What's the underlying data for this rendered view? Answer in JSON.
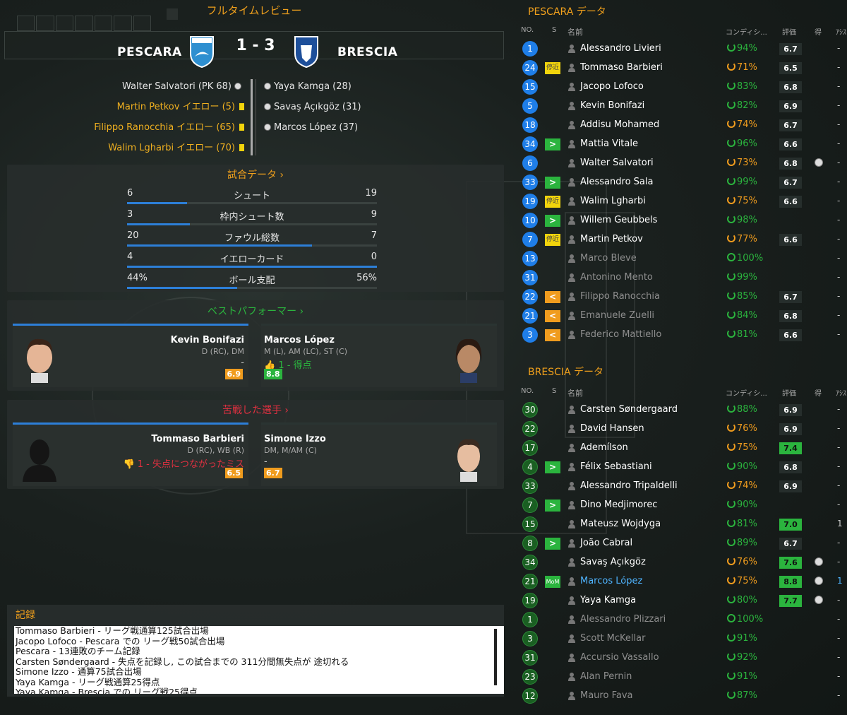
{
  "header": {
    "title": "フルタイムレビュー"
  },
  "match": {
    "home": "PESCARA",
    "away": "BRESCIA",
    "score": "1 - 3"
  },
  "events": {
    "home": [
      {
        "text": "Walter Salvatori (PK 68)",
        "type": "goal"
      },
      {
        "text": "Martin Petkov イエロー (5)",
        "type": "yellow"
      },
      {
        "text": "Filippo Ranocchia イエロー (65)",
        "type": "yellow"
      },
      {
        "text": "Walim Lgharbi イエロー (70)",
        "type": "yellow"
      }
    ],
    "away": [
      {
        "text": "Yaya Kamga (28)",
        "type": "goal"
      },
      {
        "text": "Savaş Açıkgöz (31)",
        "type": "goal"
      },
      {
        "text": "Marcos López (37)",
        "type": "goal"
      }
    ]
  },
  "stats": {
    "title": "試合データ",
    "rows": [
      {
        "label": "シュート",
        "home": "6",
        "away": "19",
        "home_share": 0.24
      },
      {
        "label": "枠内シュート数",
        "home": "3",
        "away": "9",
        "home_share": 0.25
      },
      {
        "label": "ファウル総数",
        "home": "20",
        "away": "7",
        "home_share": 0.74
      },
      {
        "label": "イエローカード",
        "home": "4",
        "away": "0",
        "home_share": 1.0
      },
      {
        "label": "ボール支配",
        "home": "44%",
        "away": "56%",
        "home_share": 0.44
      }
    ]
  },
  "best": {
    "title": "ベストパフォーマー",
    "home": {
      "name": "Kevin Bonifazi",
      "pos": "D (RC), DM",
      "note": "-",
      "rating": "6.9"
    },
    "away": {
      "name": "Marcos López",
      "pos": "M (L), AM (LC), ST (C)",
      "note": "1 - 得点",
      "rating": "8.8"
    }
  },
  "worst": {
    "title": "苦戦した選手",
    "home": {
      "name": "Tommaso Barbieri",
      "pos": "D (RC), WB (R)",
      "note": "1 - 失点につながったミス",
      "rating": "6.5"
    },
    "away": {
      "name": "Simone Izzo",
      "pos": "DM, M/AM (C)",
      "note": "-",
      "rating": "6.7"
    }
  },
  "log": {
    "title": "記録",
    "lines": [
      "Tommaso Barbieri - リーグ戦通算125試合出場",
      "Jacopo Lofoco - Pescara での リーグ戦50試合出場",
      "Pescara - 13連敗のチーム記録",
      "Carsten Søndergaard - 失点を記録し, この試合までの 311分間無失点が 途切れる",
      "Simone Izzo - 通算75試合出場",
      "Yaya Kamga - リーグ戦通算25得点",
      "Yaya Kamga - Brescia での リーグ戦25得点"
    ]
  },
  "pescara_data": {
    "title": "PESCARA データ",
    "columns": {
      "no": "NO.",
      "s": "S",
      "name": "名前",
      "cond": "コンディシ...",
      "rating": "評価",
      "goals": "得",
      "assists": "ｱｼｽ"
    },
    "players": [
      {
        "no": "1",
        "tag": "",
        "name": "Alessandro Livieri",
        "cond": "94%",
        "rating": "6.7",
        "goal": false,
        "ast": "-",
        "dim": false
      },
      {
        "no": "24",
        "tag": "停近",
        "name": "Tommaso Barbieri",
        "cond": "71%",
        "rating": "6.5",
        "goal": false,
        "ast": "-",
        "dim": false
      },
      {
        "no": "15",
        "tag": "",
        "name": "Jacopo Lofoco",
        "cond": "83%",
        "rating": "6.8",
        "goal": false,
        "ast": "-",
        "dim": false
      },
      {
        "no": "5",
        "tag": "",
        "name": "Kevin Bonifazi",
        "cond": "82%",
        "rating": "6.9",
        "goal": false,
        "ast": "-",
        "dim": false
      },
      {
        "no": "18",
        "tag": "",
        "name": "Addisu Mohamed",
        "cond": "74%",
        "rating": "6.7",
        "goal": false,
        "ast": "-",
        "dim": false
      },
      {
        "no": "34",
        "tag": ">",
        "name": "Mattia Vitale",
        "cond": "96%",
        "rating": "6.6",
        "goal": false,
        "ast": "-",
        "dim": false
      },
      {
        "no": "6",
        "tag": "",
        "name": "Walter Salvatori",
        "cond": "73%",
        "rating": "6.8",
        "goal": true,
        "ast": "-",
        "dim": false
      },
      {
        "no": "33",
        "tag": ">",
        "name": "Alessandro Sala",
        "cond": "99%",
        "rating": "6.7",
        "goal": false,
        "ast": "-",
        "dim": false
      },
      {
        "no": "19",
        "tag": "停近",
        "name": "Walim Lgharbi",
        "cond": "75%",
        "rating": "6.6",
        "goal": false,
        "ast": "-",
        "dim": false
      },
      {
        "no": "10",
        "tag": ">",
        "name": "Willem Geubbels",
        "cond": "98%",
        "rating": "",
        "goal": false,
        "ast": "-",
        "dim": false
      },
      {
        "no": "7",
        "tag": "停近",
        "name": "Martin Petkov",
        "cond": "77%",
        "rating": "6.6",
        "goal": false,
        "ast": "-",
        "dim": false
      },
      {
        "no": "13",
        "tag": "",
        "name": "Marco Bleve",
        "cond": "100%",
        "rating": "",
        "goal": false,
        "ast": "-",
        "dim": true
      },
      {
        "no": "31",
        "tag": "",
        "name": "Antonino Mento",
        "cond": "99%",
        "rating": "",
        "goal": false,
        "ast": "-",
        "dim": true
      },
      {
        "no": "22",
        "tag": "<",
        "name": "Filippo Ranocchia",
        "cond": "85%",
        "rating": "6.7",
        "goal": false,
        "ast": "-",
        "dim": true
      },
      {
        "no": "21",
        "tag": "<",
        "name": "Emanuele Zuelli",
        "cond": "84%",
        "rating": "6.8",
        "goal": false,
        "ast": "-",
        "dim": true
      },
      {
        "no": "3",
        "tag": "<",
        "name": "Federico Mattiello",
        "cond": "81%",
        "rating": "6.6",
        "goal": false,
        "ast": "-",
        "dim": true
      }
    ]
  },
  "brescia_data": {
    "title": "BRESCIA データ",
    "columns": {
      "no": "NO.",
      "s": "S",
      "name": "名前",
      "cond": "コンディシ...",
      "rating": "評価",
      "goals": "得",
      "assists": "ｱｼｽ"
    },
    "players": [
      {
        "no": "30",
        "tag": "",
        "name": "Carsten Søndergaard",
        "cond": "88%",
        "rating": "6.9",
        "goal": false,
        "ast": "-",
        "dim": false
      },
      {
        "no": "22",
        "tag": "",
        "name": "David Hansen",
        "cond": "76%",
        "rating": "6.9",
        "goal": false,
        "ast": "-",
        "dim": false
      },
      {
        "no": "17",
        "tag": "",
        "name": "Ademílson",
        "cond": "75%",
        "rating": "7.4",
        "goal": false,
        "ast": "-",
        "dim": false
      },
      {
        "no": "4",
        "tag": ">",
        "name": "Félix Sebastiani",
        "cond": "90%",
        "rating": "6.8",
        "goal": false,
        "ast": "-",
        "dim": false
      },
      {
        "no": "33",
        "tag": "",
        "name": "Alessandro Tripaldelli",
        "cond": "74%",
        "rating": "6.9",
        "goal": false,
        "ast": "-",
        "dim": false
      },
      {
        "no": "7",
        "tag": ">",
        "name": "Dino Medjimorec",
        "cond": "90%",
        "rating": "",
        "goal": false,
        "ast": "-",
        "dim": false
      },
      {
        "no": "15",
        "tag": "",
        "name": "Mateusz Wojdyga",
        "cond": "81%",
        "rating": "7.0",
        "goal": false,
        "ast": "1",
        "dim": false
      },
      {
        "no": "8",
        "tag": ">",
        "name": "João Cabral",
        "cond": "89%",
        "rating": "6.7",
        "goal": false,
        "ast": "-",
        "dim": false
      },
      {
        "no": "34",
        "tag": "",
        "name": "Savaş Açıkgöz",
        "cond": "76%",
        "rating": "7.6",
        "goal": true,
        "ast": "-",
        "dim": false
      },
      {
        "no": "21",
        "tag": "MoM",
        "name": "Marcos López",
        "cond": "75%",
        "rating": "8.8",
        "goal": true,
        "ast": "1",
        "dim": false
      },
      {
        "no": "19",
        "tag": "",
        "name": "Yaya Kamga",
        "cond": "80%",
        "rating": "7.7",
        "goal": true,
        "ast": "-",
        "dim": false
      },
      {
        "no": "1",
        "tag": "",
        "name": "Alessandro Plizzari",
        "cond": "100%",
        "rating": "",
        "goal": false,
        "ast": "-",
        "dim": true
      },
      {
        "no": "3",
        "tag": "",
        "name": "Scott McKellar",
        "cond": "91%",
        "rating": "",
        "goal": false,
        "ast": "-",
        "dim": true
      },
      {
        "no": "31",
        "tag": "",
        "name": "Accursio Vassallo",
        "cond": "92%",
        "rating": "",
        "goal": false,
        "ast": "-",
        "dim": true
      },
      {
        "no": "23",
        "tag": "",
        "name": "Alan Pernin",
        "cond": "91%",
        "rating": "",
        "goal": false,
        "ast": "-",
        "dim": true
      },
      {
        "no": "12",
        "tag": "",
        "name": "Mauro Fava",
        "cond": "87%",
        "rating": "",
        "goal": false,
        "ast": "-",
        "dim": true
      }
    ]
  },
  "colors": {
    "accent": "#f0a01c",
    "blue": "#2d7fd8",
    "green": "#2bb43e",
    "yellow": "#f2d40c",
    "red": "#e03040"
  }
}
